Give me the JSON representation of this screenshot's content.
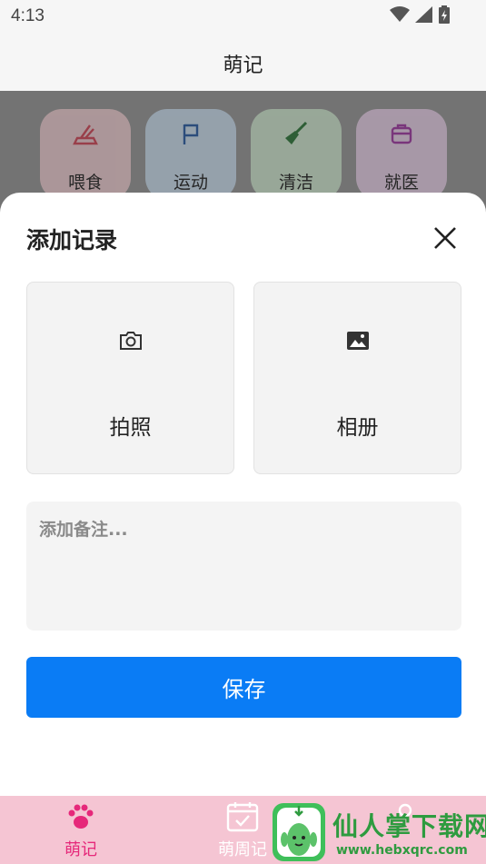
{
  "status_bar": {
    "time": "4:13"
  },
  "app_bar": {
    "title": "萌记"
  },
  "quick_actions": [
    {
      "label": "喂食",
      "color": "#f3d2d6",
      "icon": "feeding-icon"
    },
    {
      "label": "运动",
      "color": "#cfe2f3",
      "icon": "flag-icon"
    },
    {
      "label": "清洁",
      "color": "#d4ecd4",
      "icon": "broom-icon"
    },
    {
      "label": "就医",
      "color": "#ecd4ec",
      "icon": "medical-kit-icon"
    }
  ],
  "sheet": {
    "title": "添加记录",
    "camera_label": "拍照",
    "album_label": "相册",
    "note_placeholder": "添加备注...",
    "save_label": "保存"
  },
  "tab_bar": {
    "tabs": [
      {
        "label": "萌记",
        "icon": "paw-icon",
        "active": true
      },
      {
        "label": "萌周记",
        "icon": "calendar-check-icon",
        "active": false
      },
      {
        "label": "",
        "icon": "profile-icon",
        "active": false
      }
    ]
  },
  "watermark": {
    "text": "仙人掌下载网",
    "url": "www.hebxqrc.com"
  },
  "colors": {
    "primary": "#0a7cf5",
    "tab_active": "#e6287a",
    "tab_bar_bg": "#f5c5d3"
  }
}
